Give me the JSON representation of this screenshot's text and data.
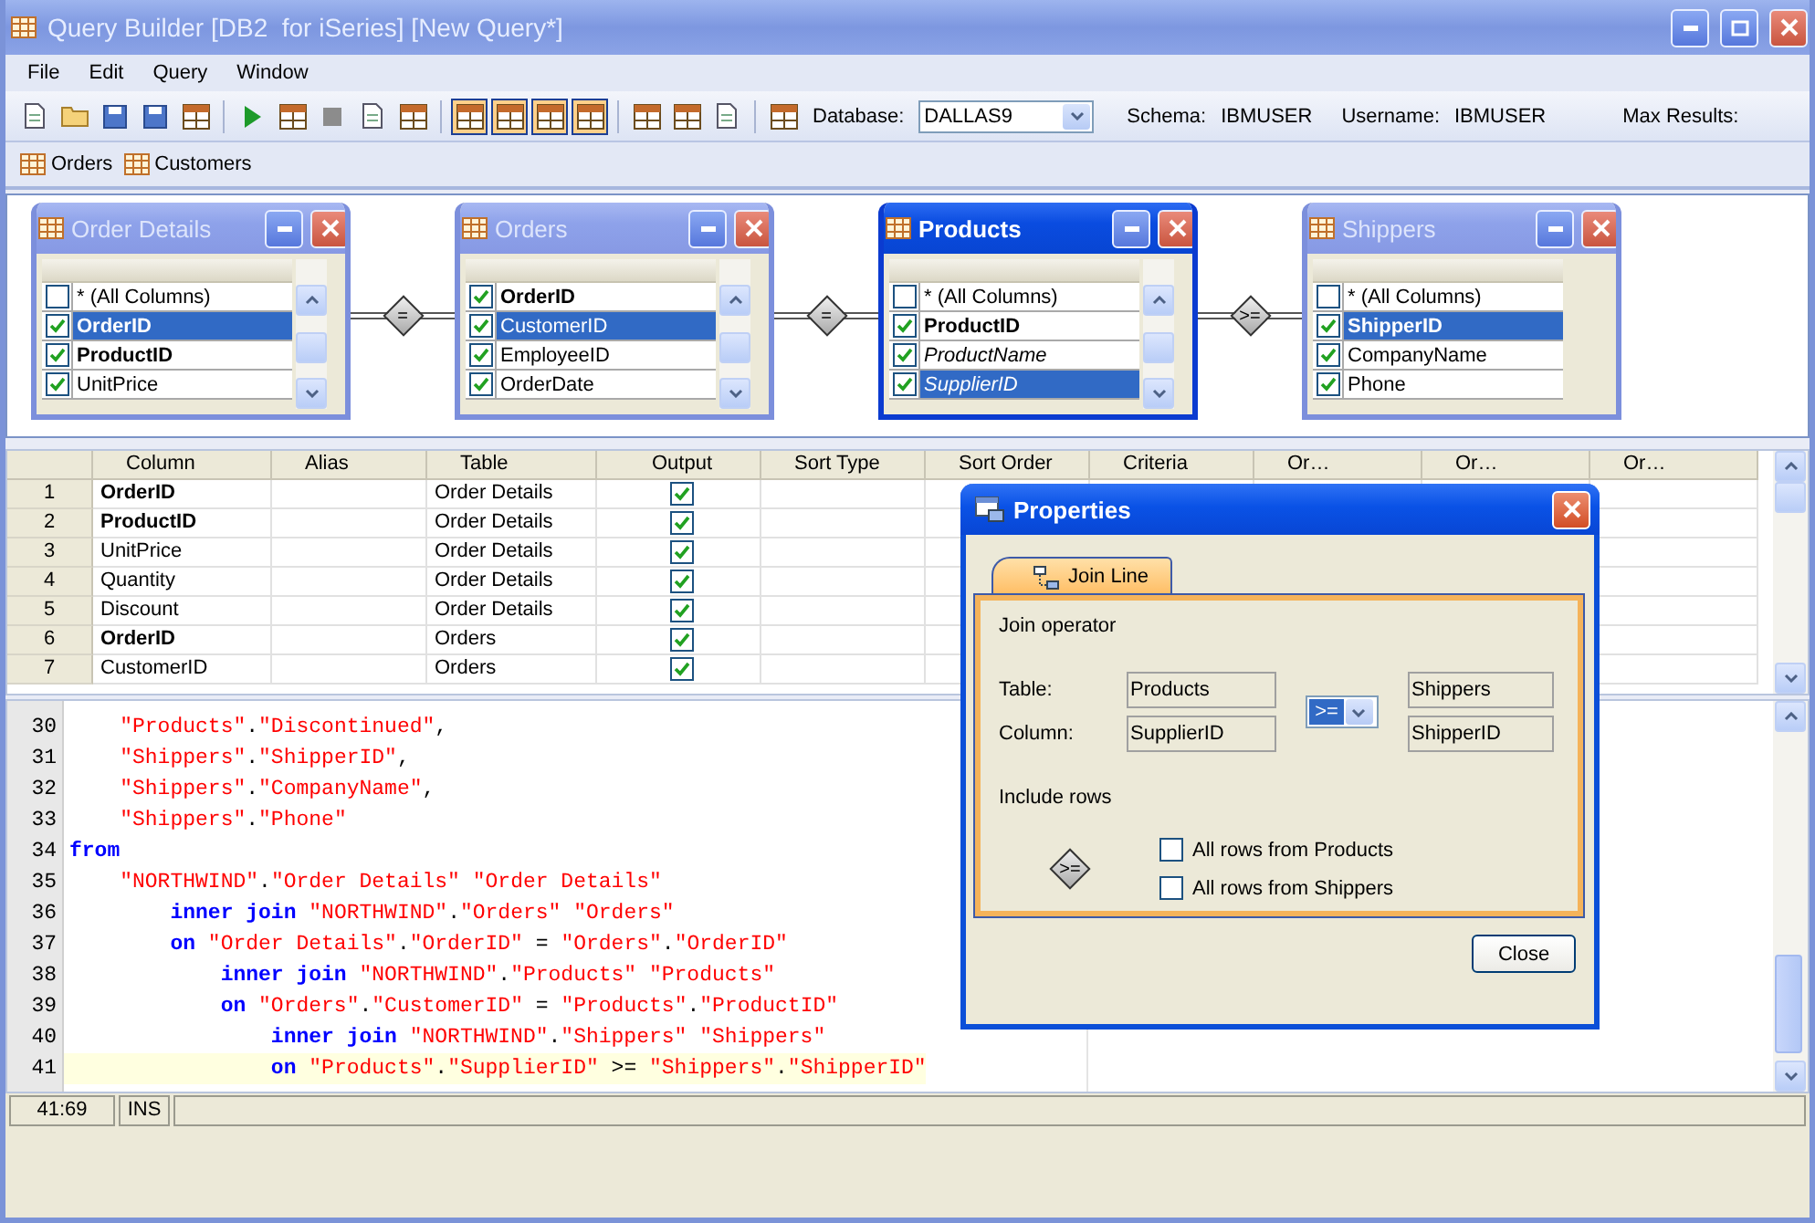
{
  "window": {
    "title": "Query Builder [DB2  for iSeries] [New Query*]"
  },
  "menu": [
    "File",
    "Edit",
    "Query",
    "Window"
  ],
  "toolbar": {
    "tools": [
      {
        "kind": "page",
        "pressed": false
      },
      {
        "kind": "folder",
        "pressed": false
      },
      {
        "kind": "disk",
        "pressed": false
      },
      {
        "kind": "disk",
        "pressed": false
      },
      {
        "kind": "grid",
        "pressed": false
      },
      {
        "kind": "separator"
      },
      {
        "kind": "play",
        "pressed": false
      },
      {
        "kind": "grid",
        "pressed": false
      },
      {
        "kind": "stop",
        "pressed": false
      },
      {
        "kind": "page",
        "pressed": false
      },
      {
        "kind": "grid",
        "pressed": false
      },
      {
        "kind": "separator"
      },
      {
        "kind": "grid",
        "pressed": true
      },
      {
        "kind": "grid",
        "pressed": true
      },
      {
        "kind": "grid",
        "pressed": true
      },
      {
        "kind": "grid",
        "pressed": true
      },
      {
        "kind": "separator"
      },
      {
        "kind": "grid",
        "pressed": false
      },
      {
        "kind": "grid",
        "pressed": false
      },
      {
        "kind": "page",
        "pressed": false
      },
      {
        "kind": "separator"
      },
      {
        "kind": "grid",
        "pressed": false
      }
    ],
    "database_label": "Database:",
    "database": "DALLAS9",
    "schema_label": "Schema:",
    "schema": "IBMUSER",
    "username_label": "Username:",
    "username": "IBMUSER",
    "max_results_label": "Max Results:"
  },
  "query_tabs": [
    {
      "label": "Orders"
    },
    {
      "label": "Customers"
    }
  ],
  "diagram": {
    "tables": [
      {
        "title": "Order Details",
        "active": false,
        "scrollable": true,
        "columns": [
          {
            "name": "* (All Columns)",
            "checked": false,
            "selected": false,
            "bold": false,
            "italic": false
          },
          {
            "name": "OrderID",
            "checked": true,
            "selected": true,
            "bold": true,
            "italic": false
          },
          {
            "name": "ProductID",
            "checked": true,
            "selected": false,
            "bold": true,
            "italic": false
          },
          {
            "name": "UnitPrice",
            "checked": true,
            "selected": false,
            "bold": false,
            "italic": false
          }
        ]
      },
      {
        "title": "Orders",
        "active": false,
        "scrollable": true,
        "columns": [
          {
            "name": "OrderID",
            "checked": true,
            "selected": false,
            "bold": true,
            "italic": false
          },
          {
            "name": "CustomerID",
            "checked": true,
            "selected": true,
            "bold": false,
            "italic": false
          },
          {
            "name": "EmployeeID",
            "checked": true,
            "selected": false,
            "bold": false,
            "italic": false
          },
          {
            "name": "OrderDate",
            "checked": true,
            "selected": false,
            "bold": false,
            "italic": false
          }
        ]
      },
      {
        "title": "Products",
        "active": true,
        "scrollable": true,
        "columns": [
          {
            "name": "* (All Columns)",
            "checked": false,
            "selected": false,
            "bold": false,
            "italic": false
          },
          {
            "name": "ProductID",
            "checked": true,
            "selected": false,
            "bold": true,
            "italic": false
          },
          {
            "name": "ProductName",
            "checked": true,
            "selected": false,
            "bold": false,
            "italic": true
          },
          {
            "name": "SupplierID",
            "checked": true,
            "selected": true,
            "bold": false,
            "italic": true
          }
        ]
      },
      {
        "title": "Shippers",
        "active": false,
        "scrollable": false,
        "columns": [
          {
            "name": "* (All Columns)",
            "checked": false,
            "selected": false,
            "bold": false,
            "italic": false
          },
          {
            "name": "ShipperID",
            "checked": true,
            "selected": true,
            "bold": true,
            "italic": false
          },
          {
            "name": "CompanyName",
            "checked": true,
            "selected": false,
            "bold": false,
            "italic": false
          },
          {
            "name": "Phone",
            "checked": true,
            "selected": false,
            "bold": false,
            "italic": false
          }
        ]
      }
    ],
    "joins": [
      {
        "operator": "="
      },
      {
        "operator": "="
      },
      {
        "operator": ">="
      }
    ]
  },
  "grid": {
    "columns": [
      "Column",
      "Alias",
      "Table",
      "Output",
      "Sort Type",
      "Sort Order",
      "Criteria",
      "Or…",
      "Or…",
      "Or…"
    ],
    "rows": [
      {
        "number": "1",
        "column": "OrderID",
        "bold": true,
        "table": "Order Details",
        "output": true
      },
      {
        "number": "2",
        "column": "ProductID",
        "bold": true,
        "table": "Order Details",
        "output": true
      },
      {
        "number": "3",
        "column": "UnitPrice",
        "bold": false,
        "table": "Order Details",
        "output": true
      },
      {
        "number": "4",
        "column": "Quantity",
        "bold": false,
        "table": "Order Details",
        "output": true
      },
      {
        "number": "5",
        "column": "Discount",
        "bold": false,
        "table": "Order Details",
        "output": true
      },
      {
        "number": "6",
        "column": "OrderID",
        "bold": true,
        "table": "Orders",
        "output": true
      },
      {
        "number": "7",
        "column": "CustomerID",
        "bold": false,
        "table": "Orders",
        "output": true
      }
    ]
  },
  "sql": {
    "lines": [
      {
        "number": "30",
        "current": false,
        "tokens": [
          {
            "kind": "string",
            "text": "    \"Products\""
          },
          {
            "kind": "plain",
            "text": "."
          },
          {
            "kind": "string",
            "text": "\"Discontinued\""
          },
          {
            "kind": "plain",
            "text": ","
          }
        ]
      },
      {
        "number": "31",
        "current": false,
        "tokens": [
          {
            "kind": "string",
            "text": "    \"Shippers\""
          },
          {
            "kind": "plain",
            "text": "."
          },
          {
            "kind": "string",
            "text": "\"ShipperID\""
          },
          {
            "kind": "plain",
            "text": ","
          }
        ]
      },
      {
        "number": "32",
        "current": false,
        "tokens": [
          {
            "kind": "string",
            "text": "    \"Shippers\""
          },
          {
            "kind": "plain",
            "text": "."
          },
          {
            "kind": "string",
            "text": "\"CompanyName\""
          },
          {
            "kind": "plain",
            "text": ","
          }
        ]
      },
      {
        "number": "33",
        "current": false,
        "tokens": [
          {
            "kind": "string",
            "text": "    \"Shippers\""
          },
          {
            "kind": "plain",
            "text": "."
          },
          {
            "kind": "string",
            "text": "\"Phone\""
          }
        ]
      },
      {
        "number": "34",
        "current": false,
        "tokens": [
          {
            "kind": "keyword",
            "text": "from"
          }
        ]
      },
      {
        "number": "35",
        "current": false,
        "tokens": [
          {
            "kind": "string",
            "text": "    \"NORTHWIND\""
          },
          {
            "kind": "plain",
            "text": "."
          },
          {
            "kind": "string",
            "text": "\"Order Details\""
          },
          {
            "kind": "string",
            "text": " \"Order Details\""
          }
        ]
      },
      {
        "number": "36",
        "current": false,
        "tokens": [
          {
            "kind": "keyword",
            "text": "        inner join"
          },
          {
            "kind": "string",
            "text": " \"NORTHWIND\""
          },
          {
            "kind": "plain",
            "text": "."
          },
          {
            "kind": "string",
            "text": "\"Orders\""
          },
          {
            "kind": "string",
            "text": " \"Orders\""
          }
        ]
      },
      {
        "number": "37",
        "current": false,
        "tokens": [
          {
            "kind": "keyword",
            "text": "        on"
          },
          {
            "kind": "string",
            "text": " \"Order Details\""
          },
          {
            "kind": "plain",
            "text": "."
          },
          {
            "kind": "string",
            "text": "\"OrderID\""
          },
          {
            "kind": "plain",
            "text": " = "
          },
          {
            "kind": "string",
            "text": "\"Orders\""
          },
          {
            "kind": "plain",
            "text": "."
          },
          {
            "kind": "string",
            "text": "\"OrderID\""
          }
        ]
      },
      {
        "number": "38",
        "current": false,
        "tokens": [
          {
            "kind": "keyword",
            "text": "            inner join"
          },
          {
            "kind": "string",
            "text": " \"NORTHWIND\""
          },
          {
            "kind": "plain",
            "text": "."
          },
          {
            "kind": "string",
            "text": "\"Products\""
          },
          {
            "kind": "string",
            "text": " \"Products\""
          }
        ]
      },
      {
        "number": "39",
        "current": false,
        "tokens": [
          {
            "kind": "keyword",
            "text": "            on"
          },
          {
            "kind": "string",
            "text": " \"Orders\""
          },
          {
            "kind": "plain",
            "text": "."
          },
          {
            "kind": "string",
            "text": "\"CustomerID\""
          },
          {
            "kind": "plain",
            "text": " = "
          },
          {
            "kind": "string",
            "text": "\"Products\""
          },
          {
            "kind": "plain",
            "text": "."
          },
          {
            "kind": "string",
            "text": "\"ProductID\""
          }
        ]
      },
      {
        "number": "40",
        "current": false,
        "tokens": [
          {
            "kind": "keyword",
            "text": "                inner join"
          },
          {
            "kind": "string",
            "text": " \"NORTHWIND\""
          },
          {
            "kind": "plain",
            "text": "."
          },
          {
            "kind": "string",
            "text": "\"Shippers\""
          },
          {
            "kind": "string",
            "text": " \"Shippers\""
          }
        ]
      },
      {
        "number": "41",
        "current": true,
        "tokens": [
          {
            "kind": "keyword",
            "text": "                on"
          },
          {
            "kind": "string",
            "text": " \"Products\""
          },
          {
            "kind": "plain",
            "text": "."
          },
          {
            "kind": "string",
            "text": "\"SupplierID\""
          },
          {
            "kind": "plain",
            "text": " >= "
          },
          {
            "kind": "string",
            "text": "\"Shippers\""
          },
          {
            "kind": "plain",
            "text": "."
          },
          {
            "kind": "string",
            "text": "\"ShipperID\""
          }
        ]
      }
    ]
  },
  "status_bar": {
    "position": "41:69",
    "mode": "INS"
  },
  "dialog": {
    "title": "Properties",
    "tabs": [
      {
        "label": "Join Line",
        "selected": true
      }
    ],
    "join_operator_label": "Join operator",
    "table_label": "Table:",
    "column_label": "Column:",
    "left_table": "Products",
    "left_column": "SupplierID",
    "operator": ">=",
    "right_table": "Shippers",
    "right_column": "ShipperID",
    "include_rows_label": "Include rows",
    "diagram_operator": ">=",
    "options": [
      {
        "label": "All rows from Products",
        "checked": false
      },
      {
        "label": "All rows from Shippers",
        "checked": false
      }
    ],
    "close_button": "Close"
  }
}
